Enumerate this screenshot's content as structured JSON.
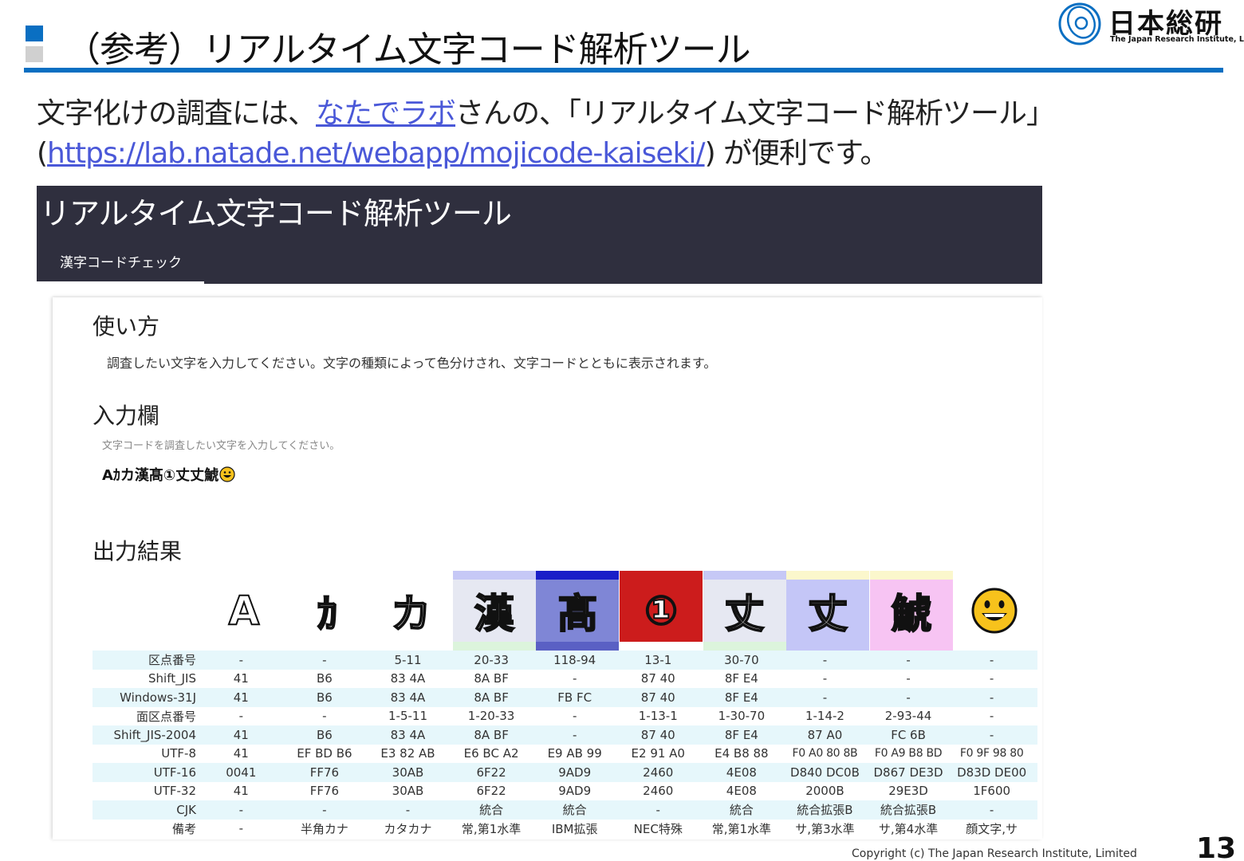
{
  "slide": {
    "title": "（参考）リアルタイム文字コード解析ツール",
    "intro_pre": "文字化けの調査には、",
    "intro_link1": "なたでラボ",
    "intro_mid": "さんの、「リアルタイム文字コード解析ツール」",
    "intro_paren_open": "(",
    "intro_link2": "https://lab.natade.net/webapp/mojicode-kaiseki/",
    "intro_post": ") が便利です。",
    "copyright": "Copyright (c) The Japan Research Institute, Limited",
    "page_number": "13"
  },
  "logo": {
    "jp": "日本総研",
    "en": "The Japan Research Institute, Limited"
  },
  "app": {
    "title": "リアルタイム文字コード解析ツール",
    "tab": "漢字コードチェック",
    "usage_heading": "使い方",
    "usage_text": "調査したい文字を入力してください。文字の種類によって色分けされ、文字コードとともに表示されます。",
    "input_heading": "入力欄",
    "input_placeholder": "文字コードを調査したい文字を入力してください。",
    "input_value": "Aｶカ漢髙①丈丈鯱",
    "output_heading": "出力結果"
  },
  "glyphs": [
    {
      "char": "A",
      "bg": "#ffffff",
      "top": "#ffffff",
      "bottom": "#ffffff"
    },
    {
      "char": "ｶ",
      "bg": "#ffffff",
      "top": "#ffffff",
      "bottom": "#ffffff"
    },
    {
      "char": "カ",
      "bg": "#ffffff",
      "top": "#ffffff",
      "bottom": "#ffffff"
    },
    {
      "char": "漢",
      "bg": "#e6e8f2",
      "top": "#c6c8f6",
      "bottom": "#dcf4dc"
    },
    {
      "char": "髙",
      "bg": "#7f86d6",
      "top": "#1a1ec8",
      "bottom": "#5a60c4"
    },
    {
      "char": "①",
      "bg": "#cc1c1c",
      "top": "#cc1c1c",
      "bottom": "#ffffff"
    },
    {
      "char": "丈",
      "bg": "#e6e8f2",
      "top": "#c6c8f6",
      "bottom": "#dcf4dc"
    },
    {
      "char": "丈",
      "bg": "#c4c6f7",
      "top": "#fbf7cc",
      "bottom": "#c4c6f7"
    },
    {
      "char": "鯱",
      "bg": "#f7c4f3",
      "top": "#fbf7cc",
      "bottom": "#f7c4f3"
    },
    {
      "char": "",
      "bg": "#ffffff",
      "top": "#ffffff",
      "bottom": "#ffffff",
      "emoji": "grinning-face"
    }
  ],
  "table": {
    "rows": [
      {
        "label": "区点番号",
        "cells": [
          "-",
          "-",
          "5-11",
          "20-33",
          "118-94",
          "13-1",
          "30-70",
          "-",
          "-",
          "-"
        ]
      },
      {
        "label": "Shift_JIS",
        "cells": [
          "41",
          "B6",
          "83 4A",
          "8A BF",
          "-",
          "87 40",
          "8F E4",
          "-",
          "-",
          "-"
        ]
      },
      {
        "label": "Windows-31J",
        "cells": [
          "41",
          "B6",
          "83 4A",
          "8A BF",
          "FB FC",
          "87 40",
          "8F E4",
          "-",
          "-",
          "-"
        ]
      },
      {
        "label": "面区点番号",
        "cells": [
          "-",
          "-",
          "1-5-11",
          "1-20-33",
          "-",
          "1-13-1",
          "1-30-70",
          "1-14-2",
          "2-93-44",
          "-"
        ]
      },
      {
        "label": "Shift_JIS-2004",
        "cells": [
          "41",
          "B6",
          "83 4A",
          "8A BF",
          "-",
          "87 40",
          "8F E4",
          "87 A0",
          "FC 6B",
          "-"
        ]
      },
      {
        "label": "UTF-8",
        "cells": [
          "41",
          "EF BD B6",
          "E3 82 AB",
          "E6 BC A2",
          "E9 AB 99",
          "E2 91 A0",
          "E4 B8 88",
          "F0 A0 80 8B",
          "F0 A9 B8 BD",
          "F0 9F 98 80"
        ]
      },
      {
        "label": "UTF-16",
        "cells": [
          "0041",
          "FF76",
          "30AB",
          "6F22",
          "9AD9",
          "2460",
          "4E08",
          "D840 DC0B",
          "D867 DE3D",
          "D83D DE00"
        ]
      },
      {
        "label": "UTF-32",
        "cells": [
          "41",
          "FF76",
          "30AB",
          "6F22",
          "9AD9",
          "2460",
          "4E08",
          "2000B",
          "29E3D",
          "1F600"
        ]
      },
      {
        "label": "CJK",
        "cells": [
          "-",
          "-",
          "-",
          "統合",
          "統合",
          "-",
          "統合",
          "統合拡張B",
          "統合拡張B",
          "-"
        ]
      },
      {
        "label": "備考",
        "cells": [
          "-",
          "半角カナ",
          "カタカナ",
          "常,第1水準",
          "IBM拡張",
          "NEC特殊",
          "常,第1水準",
          "サ,第3水準",
          "サ,第4水準",
          "顔文字,サ"
        ]
      }
    ]
  }
}
